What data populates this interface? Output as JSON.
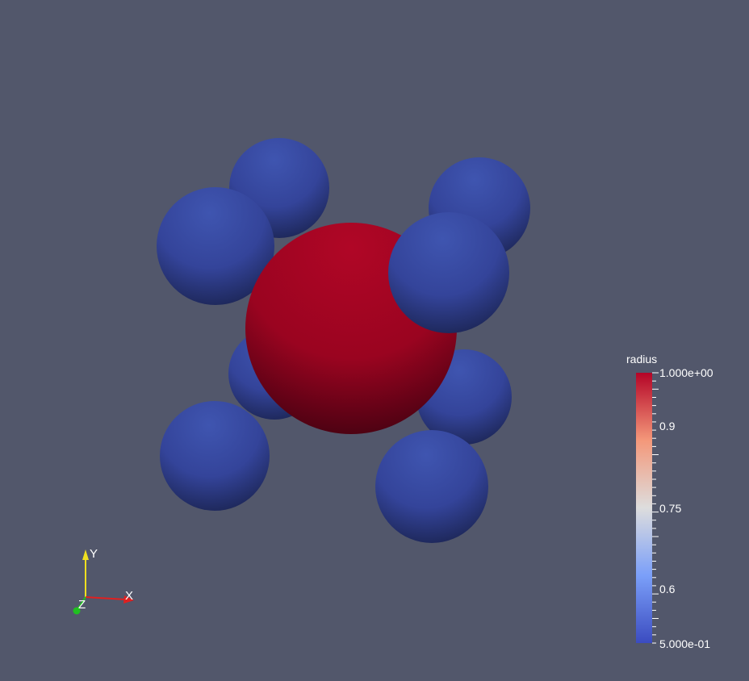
{
  "viewport": {
    "background": "#52576b"
  },
  "glyphs": {
    "color_array": "radius",
    "particles": [
      {
        "radius": 0.5,
        "color": "#3a4a9e"
      },
      {
        "radius": 0.5,
        "color": "#3a4a9e"
      },
      {
        "radius": 0.5,
        "color": "#3a4a9e"
      },
      {
        "radius": 0.5,
        "color": "#3a4a9e"
      },
      {
        "radius": 0.5,
        "color": "#3a4a9e"
      },
      {
        "radius": 1.0,
        "color": "#a3041f"
      },
      {
        "radius": 0.5,
        "color": "#3a4a9e"
      },
      {
        "radius": 0.5,
        "color": "#3a4a9e"
      },
      {
        "radius": 0.5,
        "color": "#3a4a9e"
      },
      {
        "radius": 0.5,
        "color": "#3a4a9e"
      }
    ]
  },
  "scalar_bar": {
    "title": "radius",
    "range": [
      0.5,
      1.0
    ],
    "max_label": "1.000e+00",
    "min_label": "5.000e-01",
    "tick_labels": [
      "0.9",
      "0.75",
      "0.6"
    ],
    "colormap": [
      "#3b4cc0",
      "#dddddd",
      "#b40426"
    ]
  },
  "axes_orientation": {
    "x_label": "X",
    "y_label": "Y",
    "z_label": "Z",
    "x_color": "#e02020",
    "y_color": "#f0e020",
    "z_color": "#20c020"
  }
}
